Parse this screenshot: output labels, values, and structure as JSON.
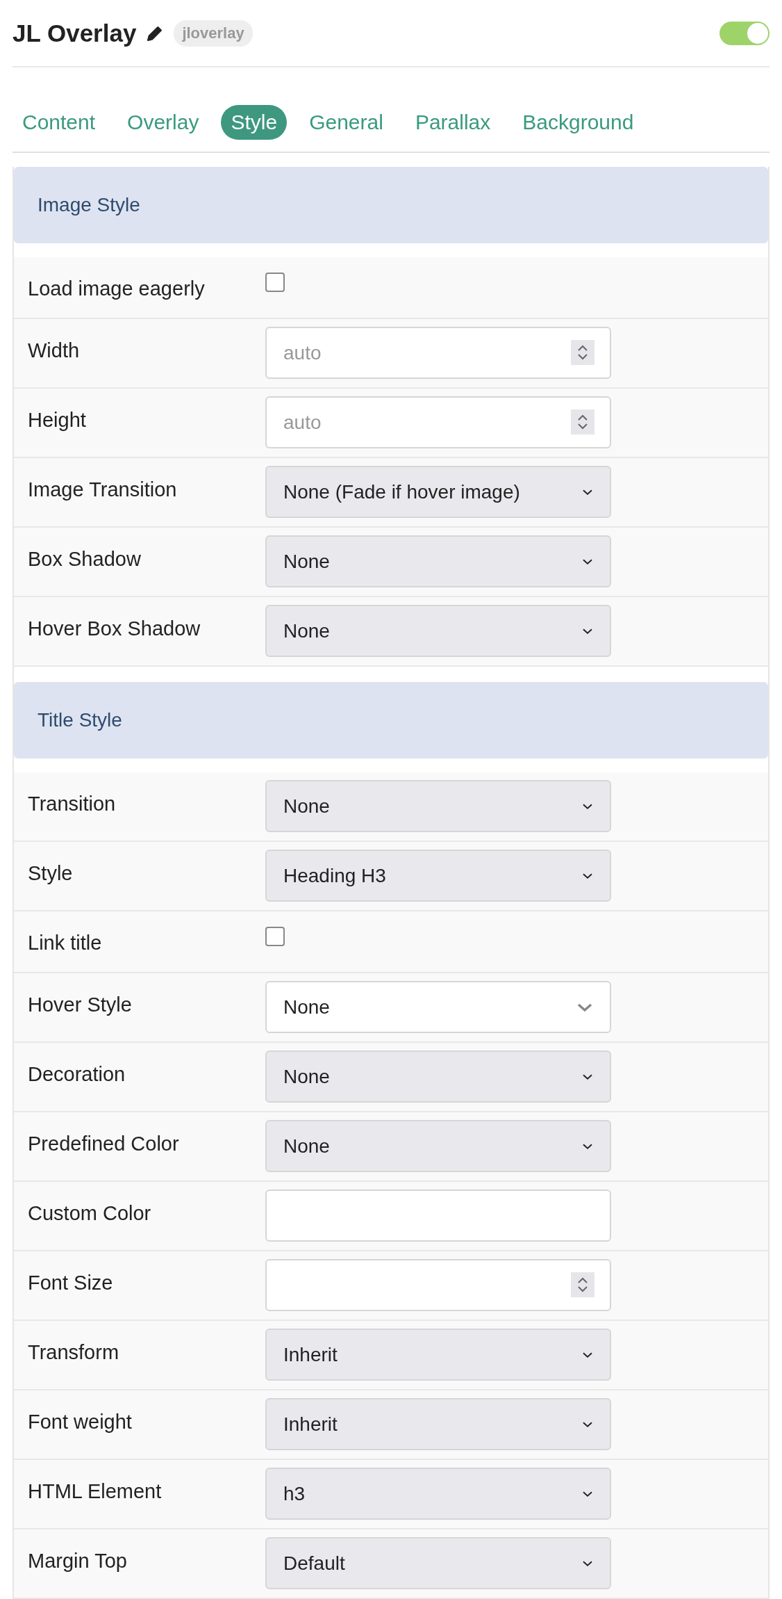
{
  "header": {
    "title": "JL Overlay",
    "badge": "jloverlay",
    "enabled": true
  },
  "tabs": [
    {
      "label": "Content",
      "selected": false
    },
    {
      "label": "Overlay",
      "selected": false
    },
    {
      "label": "Style",
      "selected": true
    },
    {
      "label": "General",
      "selected": false
    },
    {
      "label": "Parallax",
      "selected": false
    },
    {
      "label": "Background",
      "selected": false
    }
  ],
  "sections": [
    {
      "title": "Image Style",
      "fields": [
        {
          "label": "Load image eagerly",
          "kind": "checkbox",
          "checked": false
        },
        {
          "label": "Width",
          "kind": "number",
          "placeholder": "auto"
        },
        {
          "label": "Height",
          "kind": "number",
          "placeholder": "auto"
        },
        {
          "label": "Image Transition",
          "kind": "select",
          "value": "None (Fade if hover image)"
        },
        {
          "label": "Box Shadow",
          "kind": "select",
          "value": "None"
        },
        {
          "label": "Hover Box Shadow",
          "kind": "select",
          "value": "None"
        }
      ]
    },
    {
      "title": "Title Style",
      "fields": [
        {
          "label": "Transition",
          "kind": "select",
          "value": "None"
        },
        {
          "label": "Style",
          "kind": "select",
          "value": "Heading H3"
        },
        {
          "label": "Link title",
          "kind": "checkbox",
          "checked": false
        },
        {
          "label": "Hover Style",
          "kind": "dropdown",
          "value": "None"
        },
        {
          "label": "Decoration",
          "kind": "select",
          "value": "None"
        },
        {
          "label": "Predefined Color",
          "kind": "select",
          "value": "None"
        },
        {
          "label": "Custom Color",
          "kind": "text"
        },
        {
          "label": "Font Size",
          "kind": "number"
        },
        {
          "label": "Transform",
          "kind": "select",
          "value": "Inherit"
        },
        {
          "label": "Font weight",
          "kind": "select",
          "value": "Inherit"
        },
        {
          "label": "HTML Element",
          "kind": "select",
          "value": "h3"
        },
        {
          "label": "Margin Top",
          "kind": "select",
          "value": "Default"
        }
      ]
    }
  ]
}
